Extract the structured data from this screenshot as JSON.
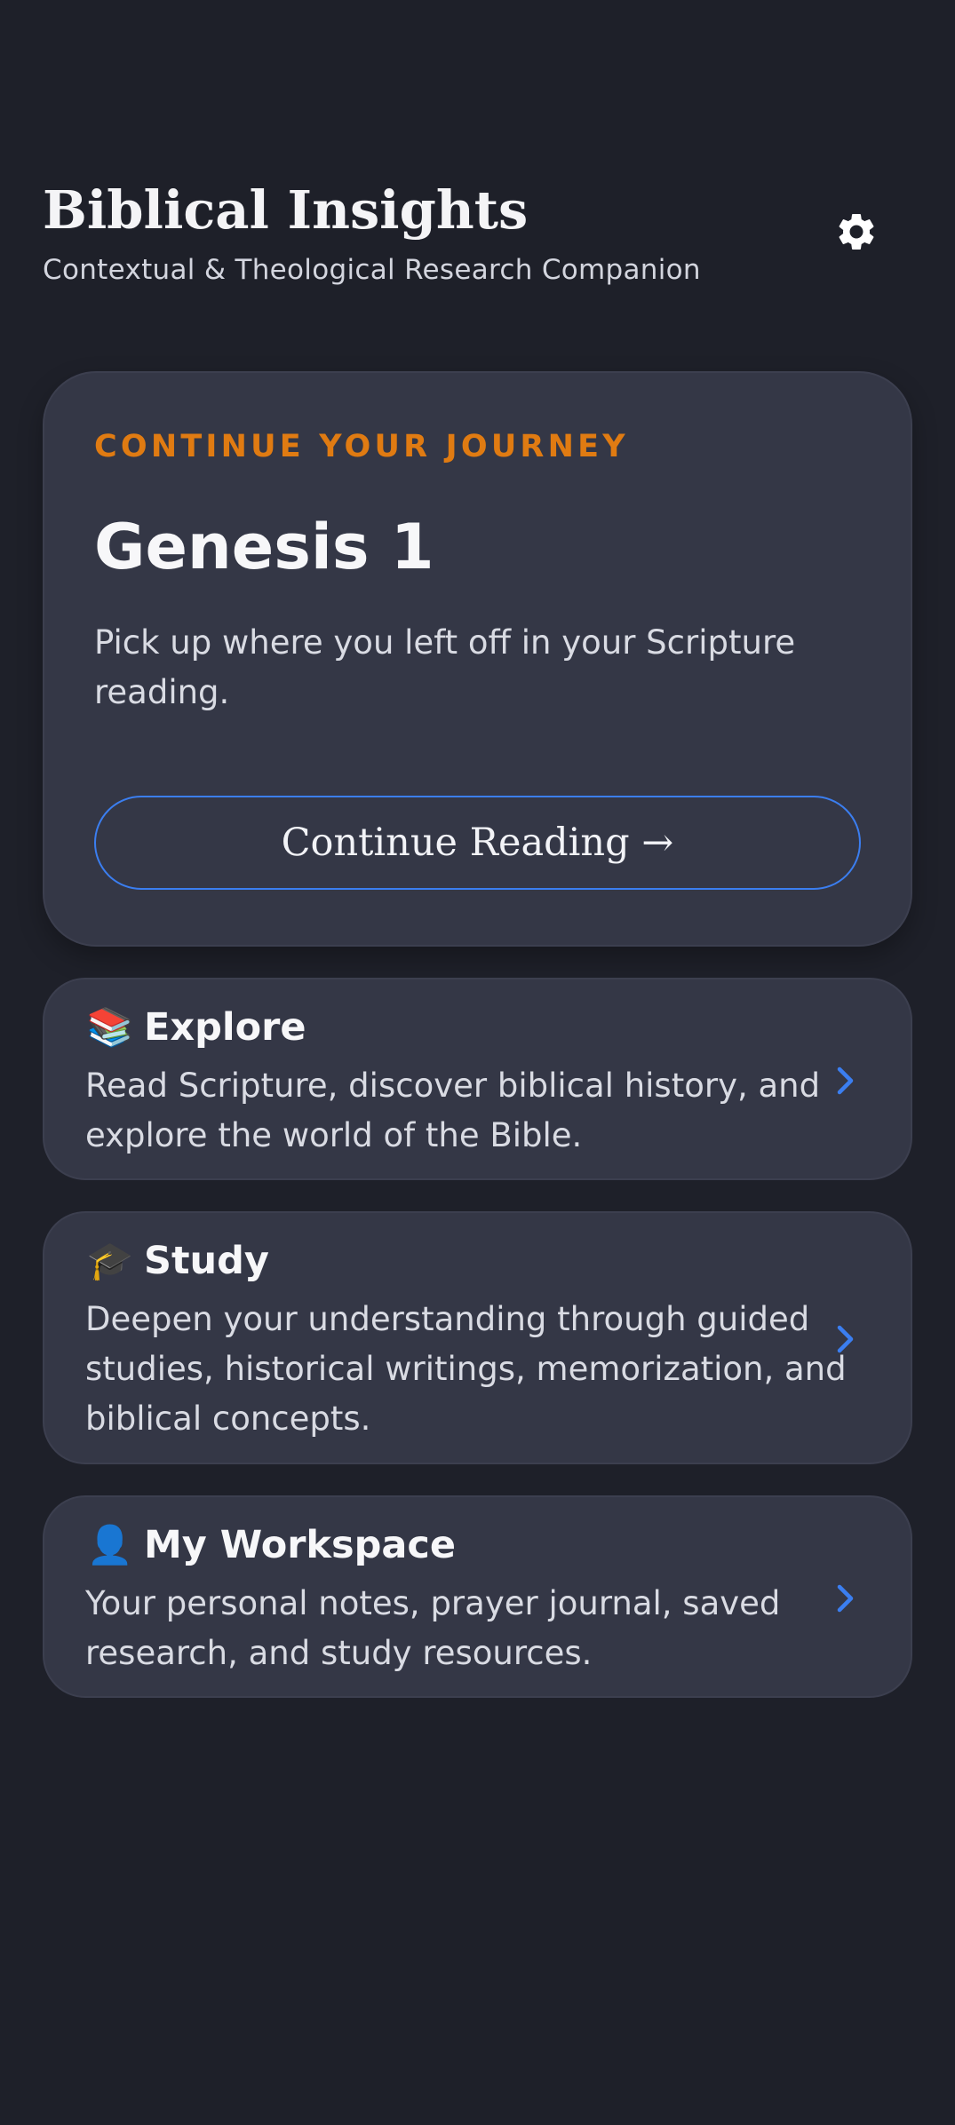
{
  "header": {
    "title": "Biblical Insights",
    "subtitle": "Contextual & Theological Research Companion",
    "settings_icon": "gear-icon"
  },
  "continue_card": {
    "eyebrow": "CONTINUE YOUR JOURNEY",
    "title": "Genesis 1",
    "description": "Pick up where you left off in your Scripture reading.",
    "button_label": "Continue Reading →",
    "accent_color": "#e07b12",
    "button_border_color": "#3b7ef0"
  },
  "sections": [
    {
      "icon": "📚",
      "icon_name": "books-icon",
      "title": "Explore",
      "description": "Read Scripture, discover biblical history, and explore the world of the Bible."
    },
    {
      "icon": "🎓",
      "icon_name": "graduation-cap-icon",
      "title": "Study",
      "description": "Deepen your understanding through guided studies, historical writings, memorization, and biblical concepts."
    },
    {
      "icon": "👤",
      "icon_name": "person-icon",
      "title": "My Workspace",
      "description": "Your personal notes, prayer journal, saved research, and study resources."
    }
  ],
  "colors": {
    "background": "#1e2029",
    "card": "#343746",
    "chevron": "#3b7ef0"
  }
}
